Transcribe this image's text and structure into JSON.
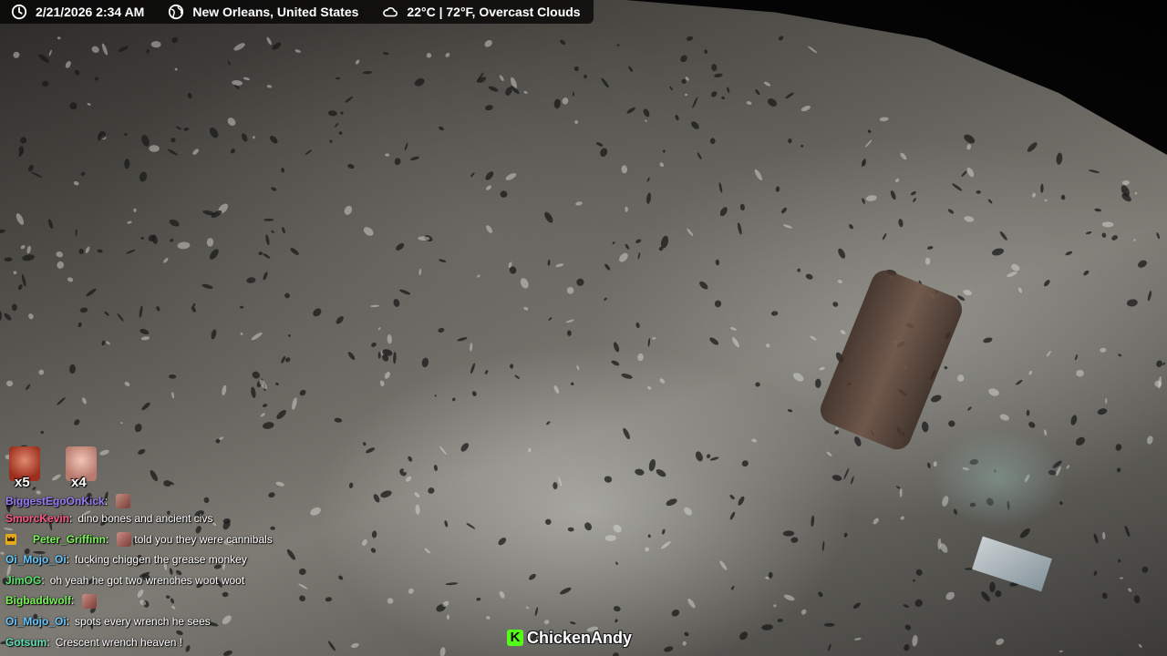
{
  "infobar": {
    "datetime": "2/21/2026 2:34 AM",
    "datetime_icon": "clock-icon",
    "location": "New Orleans, United States",
    "location_icon": "globe-icon",
    "weather": "22°C | 72°F, Overcast Clouds",
    "weather_icon": "cloud-icon"
  },
  "badges": [
    {
      "count": "x5",
      "avatar_color": "#b8452f"
    },
    {
      "count": "x4",
      "avatar_color": "#d69a8c"
    }
  ],
  "chat": [
    {
      "user": "BiggestEgoOnKick",
      "color": "#9a7dff",
      "sep": ":",
      "message": "",
      "emote": true,
      "partial": true
    },
    {
      "user": "SmorcKevin",
      "color": "#ff5a8a",
      "sep": ":",
      "message": "dino bones and ancient civs"
    },
    {
      "user": "Peter_Griffinn",
      "color": "#7cf25a",
      "sep": ":",
      "message": "told you they were cannibals",
      "emote": true,
      "badge": "crown-icon"
    },
    {
      "user": "Oi_Mojo_Oi",
      "color": "#66c8ff",
      "sep": ":",
      "message": "fucking chiggen the grease monkey"
    },
    {
      "user": "JimOG",
      "color": "#59e66a",
      "sep": ":",
      "message": "oh yeah he got two wrenches woot woot"
    },
    {
      "user": "Bigbaddwolf",
      "color": "#7cf25a",
      "sep": ":",
      "message": "",
      "emote": true
    },
    {
      "user": "Oi_Mojo_Oi",
      "color": "#66c8ff",
      "sep": ":",
      "message": "spots every wrench he sees"
    },
    {
      "user": "Gotsum",
      "color": "#5ce0b8",
      "sep": ":",
      "message": "Crescent wrench heaven !"
    }
  ],
  "watermark": {
    "logo_letter": "K",
    "channel": "ChickenAndy"
  }
}
